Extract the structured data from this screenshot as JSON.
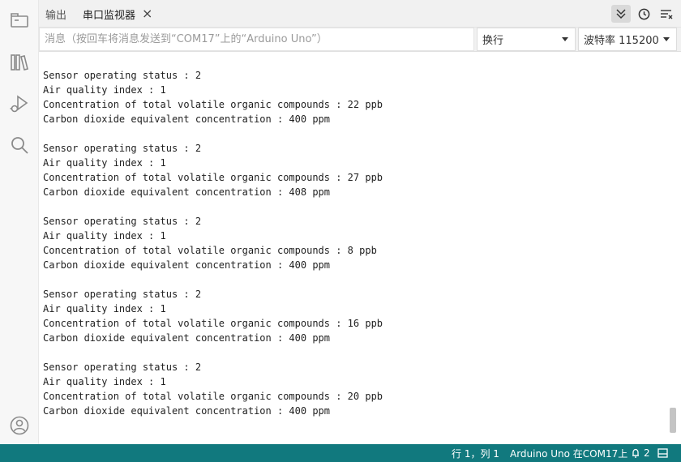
{
  "tabs": {
    "output_label": "输出",
    "serial_monitor_label": "串口监视器",
    "close_glyph": "×"
  },
  "input": {
    "placeholder": "消息（按回车将消息发送到“COM17”上的“Arduino Uno”）",
    "value": ""
  },
  "line_ending": {
    "selected": "换行"
  },
  "baud_rate": {
    "selected": "波特率 115200"
  },
  "output": {
    "lines": [
      "Sensor operating status : 2",
      "Air quality index : 1",
      "Concentration of total volatile organic compounds : 22 ppb",
      "Carbon dioxide equivalent concentration : 400 ppm",
      "",
      "Sensor operating status : 2",
      "Air quality index : 1",
      "Concentration of total volatile organic compounds : 27 ppb",
      "Carbon dioxide equivalent concentration : 408 ppm",
      "",
      "Sensor operating status : 2",
      "Air quality index : 1",
      "Concentration of total volatile organic compounds : 8 ppb",
      "Carbon dioxide equivalent concentration : 400 ppm",
      "",
      "Sensor operating status : 2",
      "Air quality index : 1",
      "Concentration of total volatile organic compounds : 16 ppb",
      "Carbon dioxide equivalent concentration : 400 ppm",
      "",
      "Sensor operating status : 2",
      "Air quality index : 1",
      "Concentration of total volatile organic compounds : 20 ppb",
      "Carbon dioxide equivalent concentration : 400 ppm"
    ]
  },
  "status": {
    "cursor_position": "行 1，列 1",
    "board_port": "Arduino Uno 在COM17上",
    "notification_count": "2"
  },
  "icons": {
    "sketchbook": "folder-icon",
    "boards": "library-icon",
    "debug": "debug-icon",
    "search": "search-icon",
    "account": "account-icon",
    "autoscroll": "chevron-double-down-icon",
    "timestamp": "clock-icon",
    "clear": "clear-output-icon",
    "notification": "bell-icon",
    "panel": "panel-icon"
  },
  "colors": {
    "status_bar": "#11797e",
    "activity_icon": "#8a8a8a"
  }
}
